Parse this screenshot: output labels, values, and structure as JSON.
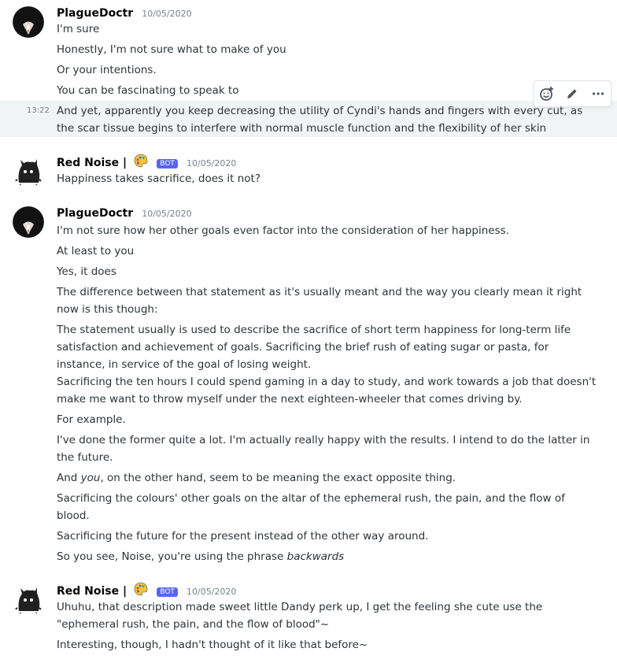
{
  "groups": [
    {
      "author": "PlagueDoctr",
      "timestamp": "10/05/2020",
      "lines": [
        "I'm sure",
        "Honestly, I'm not sure what to make of you",
        "Or your intentions.",
        "You can be fascinating to speak to",
        "And yet, apparently you keep decreasing the utility of Cyndi's hands and fingers with every cut, as the scar tissue begins to interfere with normal muscle function and the flexibility of her skin"
      ],
      "hover_time": "13:22"
    },
    {
      "author": "Red Noise |",
      "badge": "BOT",
      "timestamp": "10/05/2020",
      "lines": [
        "Happiness takes sacrifice, does it not?"
      ]
    },
    {
      "author": "PlagueDoctr",
      "timestamp": "10/05/2020",
      "lines": [
        "I'm not sure how her other goals even factor into the consideration of her happiness.",
        "At least to you",
        "Yes, it does",
        "The difference between that statement as it's usually meant and the way you clearly mean it right now is this though:",
        "The statement usually is used to describe the sacrifice of short term happiness for long-term life satisfaction and achievement of goals. Sacrificing the brief rush of eating sugar or pasta, for instance, in service of the goal of losing weight.",
        "Sacrificing the ten hours I could spend gaming in a day to study, and work towards a job that doesn't make me want to throw myself under the next eighteen-wheeler that comes driving by.",
        "For example.",
        "I've done the former quite a lot. I'm actually really happy with the results. I intend to do the latter in the future.",
        {
          "pre": "And ",
          "em": "you",
          "post": ", on the other hand, seem to be meaning the exact opposite thing."
        },
        "Sacrificing the colours' other goals on the altar of the ephemeral rush, the pain, and the flow of blood.",
        "Sacrificing the future for the present instead of the other way around.",
        {
          "pre": "So you see, Noise, you're using the phrase ",
          "em": "backwards",
          "post": ""
        }
      ]
    },
    {
      "author": "Red Noise |",
      "badge": "BOT",
      "timestamp": "10/05/2020",
      "lines": [
        "Uhuhu, that description made sweet little Dandy perk up, I get the feeling she cute use the \"ephemeral rush, the pain, and the flow of blood\"~",
        "Interesting, though, I hadn't thought of it like that before~"
      ]
    }
  ],
  "toolbar": {
    "icons": [
      "add-reaction-icon",
      "edit-icon",
      "more-icon"
    ]
  },
  "colors": {
    "bot_badge": "#5865f2",
    "hover": "#f2f3f5",
    "username": "#060607",
    "text": "#2e3338",
    "timestamp": "#747f8d"
  }
}
